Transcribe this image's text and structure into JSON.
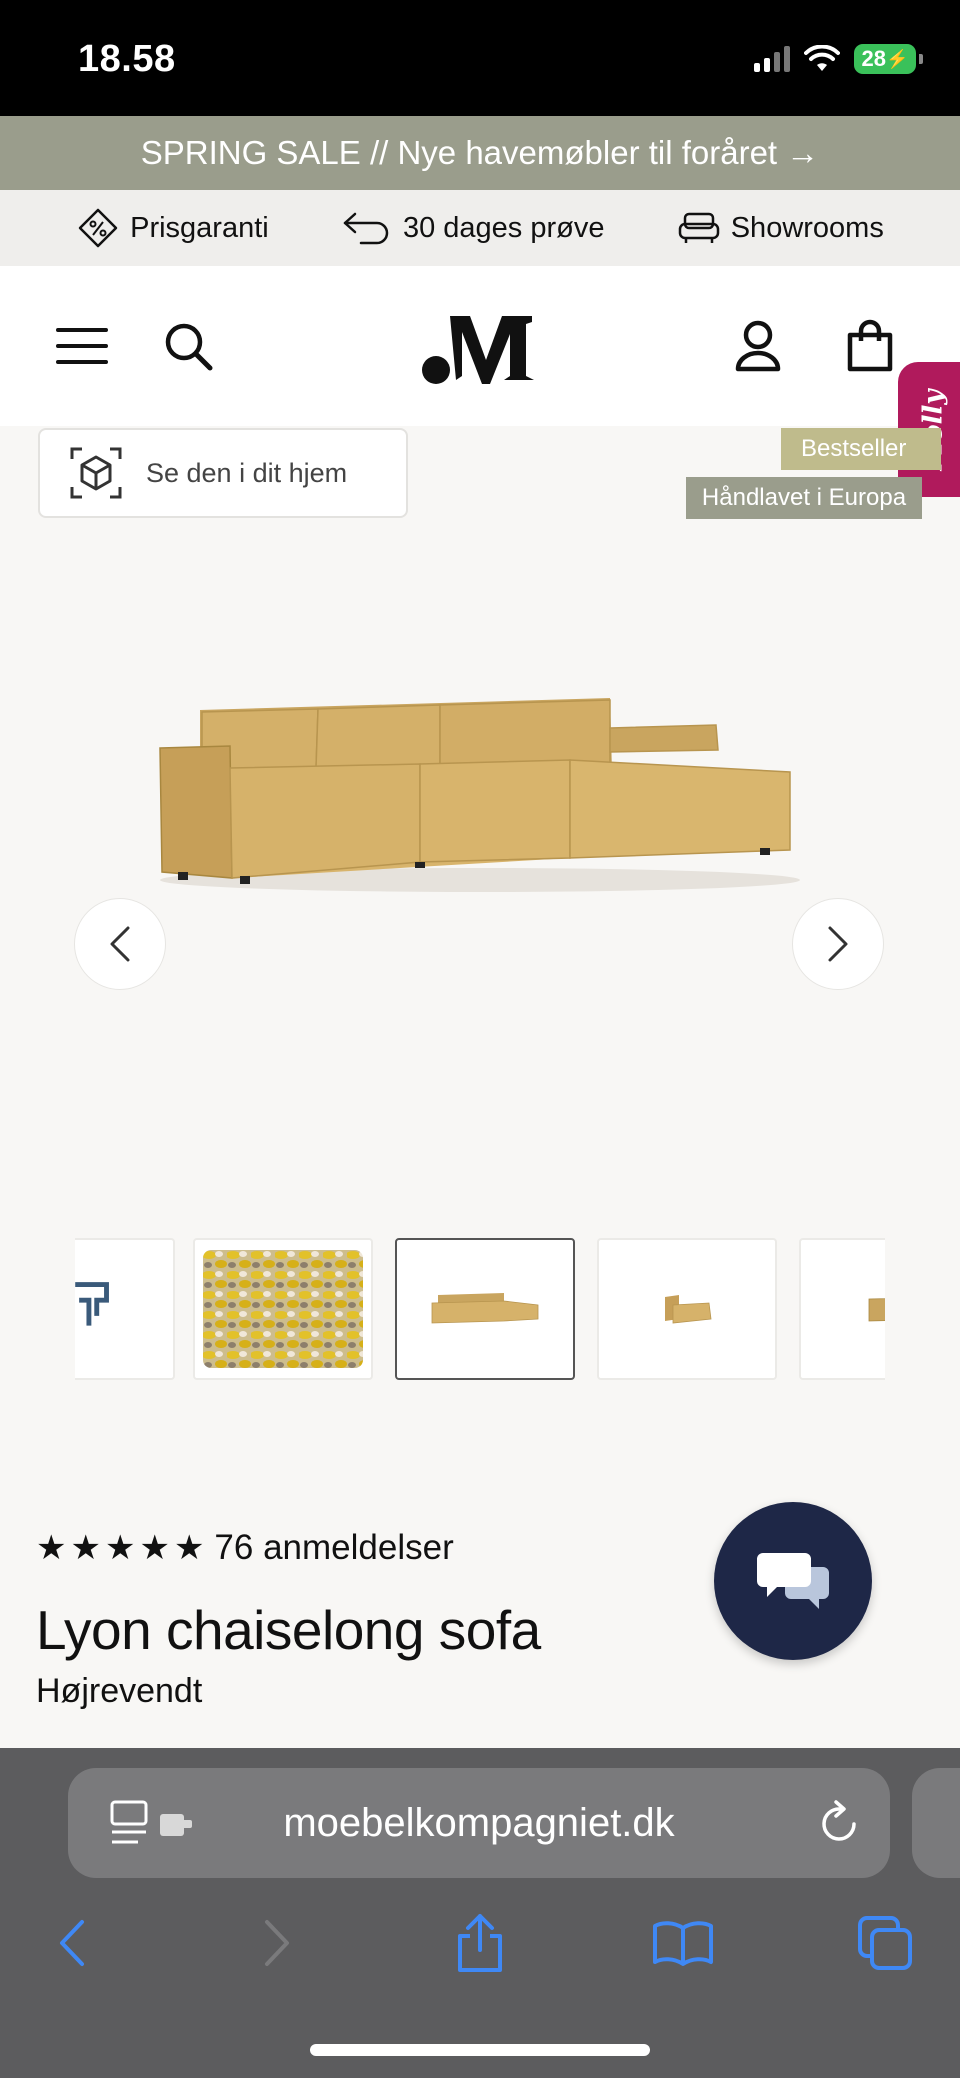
{
  "status_bar": {
    "time": "18.58",
    "battery": "28"
  },
  "promo": {
    "text": "SPRING SALE // Nye havemøbler til foråret →"
  },
  "usp": {
    "items": [
      {
        "label": "Prisgaranti",
        "icon": "price-tag-icon"
      },
      {
        "label": "30 dages prøve",
        "icon": "return-arrow-icon"
      },
      {
        "label": "Showrooms",
        "icon": "sofa-icon"
      }
    ]
  },
  "header": {
    "logo": ".M",
    "icons": [
      "menu-icon",
      "search-icon",
      "account-icon",
      "cart-icon"
    ]
  },
  "molly": {
    "label": "Molly"
  },
  "ar_button": {
    "label": "Se den i dit hjem"
  },
  "badges": {
    "bestseller": "Bestseller",
    "handmade": "Håndlavet i Europa"
  },
  "product": {
    "rating_count": "76 anmeldelser",
    "stars": 5,
    "title": "Lyon chaiselong sofa",
    "variant": "Højrevendt"
  },
  "colors": {
    "promo_bg": "#9a9d8c",
    "sofa": "#d4b069",
    "chat_bg": "#1e2747",
    "molly_bg": "#b01a5c",
    "browser_blue": "#3f88f5"
  },
  "browser": {
    "url": "moebelkompagniet.dk"
  }
}
